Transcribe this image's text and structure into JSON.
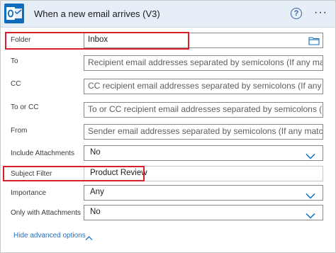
{
  "header": {
    "title": "When a new email arrives (V3)",
    "help_icon": "help-icon",
    "more_icon": "more-icon",
    "app_icon": "outlook-icon"
  },
  "fields": [
    {
      "label": "Folder",
      "value": "Inbox",
      "placeholder": ""
    },
    {
      "label": "To",
      "value": "",
      "placeholder": "Recipient email addresses separated by semicolons (If any match, the"
    },
    {
      "label": "CC",
      "value": "",
      "placeholder": "CC recipient email addresses separated by semicolons (If any match,"
    },
    {
      "label": "To or CC",
      "value": "",
      "placeholder": "To or CC recipient email addresses separated by semicolons (If any m"
    },
    {
      "label": "From",
      "value": "",
      "placeholder": "Sender email addresses separated by semicolons (If any match, the t"
    },
    {
      "label": "Include Attachments",
      "value": "No",
      "placeholder": ""
    },
    {
      "label": "Subject Filter",
      "value": "Product Review",
      "placeholder": ""
    },
    {
      "label": "Importance",
      "value": "Any",
      "placeholder": ""
    },
    {
      "label": "Only with Attachments",
      "value": "No",
      "placeholder": ""
    }
  ],
  "footer": {
    "link_label": "Hide advanced options"
  },
  "colors": {
    "highlight": "#d8202a",
    "link": "#2470c4",
    "header_bg": "#e6eef8",
    "brand": "#0f6cbd"
  }
}
